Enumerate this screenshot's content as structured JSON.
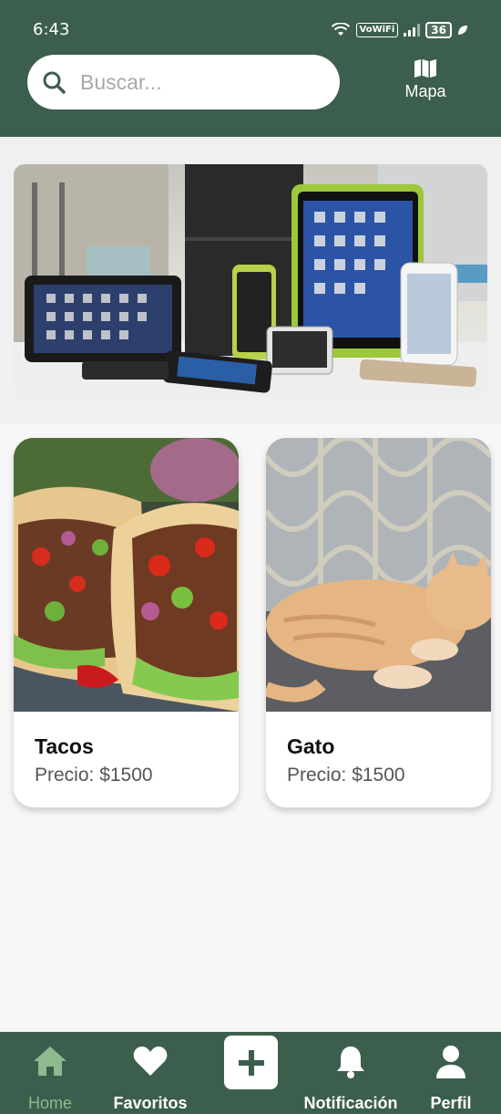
{
  "status_bar": {
    "time": "6:43",
    "network_badge": "VoWiFi",
    "battery": "36"
  },
  "header": {
    "search_placeholder": "Buscar...",
    "map_label": "Mapa"
  },
  "banner": {
    "icon": "devices-banner-image"
  },
  "products": [
    {
      "title": "Tacos",
      "price": "Precio: $1500",
      "image": "tacos-image"
    },
    {
      "title": "Gato",
      "price": "Precio: $1500",
      "image": "cat-image"
    }
  ],
  "bottom_nav": {
    "items": [
      {
        "label": "Home",
        "icon": "home-icon",
        "active": true
      },
      {
        "label": "Favoritos",
        "icon": "heart-icon"
      },
      {
        "label": "",
        "icon": "plus-icon"
      },
      {
        "label": "Notificación",
        "icon": "bell-icon"
      },
      {
        "label": "Perfil",
        "icon": "person-icon"
      }
    ]
  },
  "colors": {
    "primary": "#3b5e4d",
    "active_nav": "#8fb98f",
    "background": "#f7f7f7"
  }
}
